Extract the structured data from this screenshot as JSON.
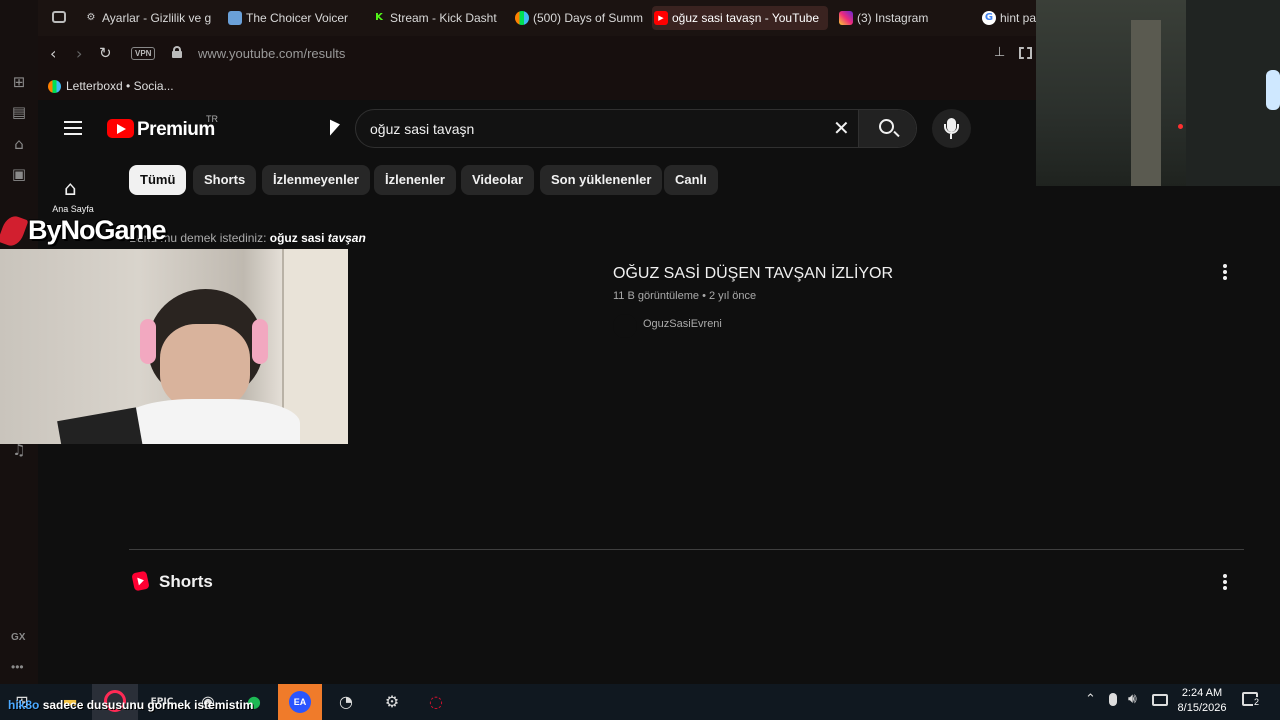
{
  "tabs": [
    {
      "label": "Ayarlar - Gizlilik ve g",
      "icon": "gear-icon"
    },
    {
      "label": "The Choicer Voicer",
      "icon": "site-icon"
    },
    {
      "label": "Stream - Kick Dasht",
      "icon": "kick-icon"
    },
    {
      "label": "(500) Days of Summ",
      "icon": "letterboxd-icon"
    },
    {
      "label": "oğuz sasi tavaşn - YouTube",
      "icon": "youtube-icon"
    },
    {
      "label": "(3) Instagram",
      "icon": "instagram-icon"
    },
    {
      "label": "hint pa",
      "icon": "google-icon"
    }
  ],
  "address": {
    "vpn": "VPN",
    "url": "www.youtube.com/results"
  },
  "bookmarks": [
    {
      "label": "Letterboxd • Socia..."
    }
  ],
  "youtube": {
    "logo_text": "Premium",
    "logo_region": "TR",
    "search_value": "oğuz sasi tavaşn",
    "chips": [
      "Tümü",
      "Shorts",
      "İzlenmeyenler",
      "İzlenenler",
      "Videolar",
      "Son yüklenenler",
      "Canlı"
    ],
    "sidebar_home_label": "Ana Sayfa",
    "did_you_mean_prefix": "Bunu mu demek istediniz:",
    "did_you_mean_plain": "oğuz sasi",
    "did_you_mean_italic": "tavşan",
    "result": {
      "title": "OĞUZ SASİ DÜŞEN TAVŞAN İZLİYOR",
      "meta": "11 B görüntüleme • 2 yıl önce",
      "channel": "OguzSasiEvreni"
    },
    "shorts_heading": "Shorts"
  },
  "overlay": {
    "streamer_logo": "ByNoGame",
    "chat_user": "hik8o",
    "chat_message": "sadece dususunu gormek istemistim"
  },
  "taskbar": {
    "time": "2:24 AM",
    "date": "8/15/2026",
    "notification_count": "2"
  },
  "gx_label": "GX"
}
